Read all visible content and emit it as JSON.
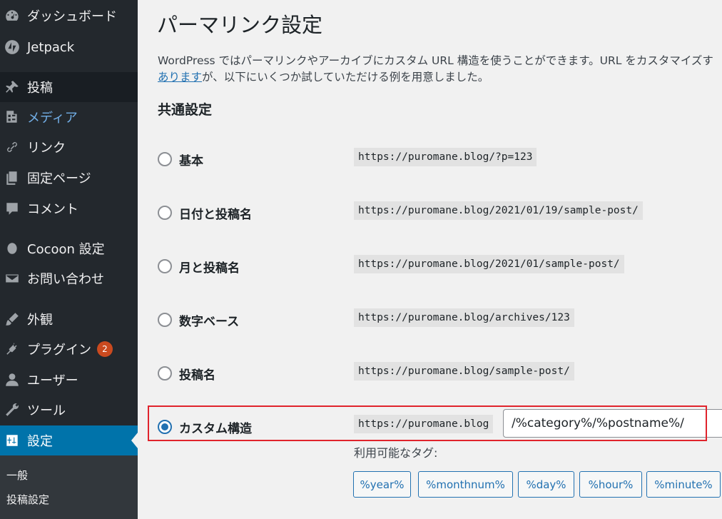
{
  "sidebar": {
    "items": [
      {
        "label": "ダッシュボード",
        "icon": "dashboard-icon"
      },
      {
        "label": "Jetpack",
        "icon": "jetpack-icon"
      },
      {
        "label": "投稿",
        "icon": "pin-icon"
      },
      {
        "label": "メディア",
        "icon": "media-icon"
      },
      {
        "label": "リンク",
        "icon": "link-icon"
      },
      {
        "label": "固定ページ",
        "icon": "pages-icon"
      },
      {
        "label": "コメント",
        "icon": "comment-icon"
      },
      {
        "label": "Cocoon 設定",
        "icon": "cocoon-icon"
      },
      {
        "label": "お問い合わせ",
        "icon": "mail-icon"
      },
      {
        "label": "外観",
        "icon": "brush-icon"
      },
      {
        "label": "プラグイン",
        "icon": "plugin-icon",
        "badge": "2"
      },
      {
        "label": "ユーザー",
        "icon": "user-icon"
      },
      {
        "label": "ツール",
        "icon": "wrench-icon"
      },
      {
        "label": "設定",
        "icon": "settings-icon"
      }
    ],
    "submenu": [
      "一般",
      "投稿設定"
    ]
  },
  "page": {
    "title": "パーマリンク設定",
    "intro_line1": "WordPress ではパーマリンクやアーカイブにカスタム URL 構造を使うことができます。URL をカスタマイズす",
    "intro_link": "あります",
    "intro_line2_rest": "が、以下にいくつか試していただける例を用意しました。",
    "section_title": "共通設定"
  },
  "options": [
    {
      "label": "基本",
      "example": "https://puromane.blog/?p=123",
      "checked": false
    },
    {
      "label": "日付と投稿名",
      "example": "https://puromane.blog/2021/01/19/sample-post/",
      "checked": false
    },
    {
      "label": "月と投稿名",
      "example": "https://puromane.blog/2021/01/sample-post/",
      "checked": false
    },
    {
      "label": "数字ベース",
      "example": "https://puromane.blog/archives/123",
      "checked": false
    },
    {
      "label": "投稿名",
      "example": "https://puromane.blog/sample-post/",
      "checked": false
    },
    {
      "label": "カスタム構造",
      "example": "https://puromane.blog",
      "checked": true
    }
  ],
  "custom_structure_value": "/%category%/%postname%/",
  "tags_label": "利用可能なタグ:",
  "tags": [
    "%year%",
    "%monthnum%",
    "%day%",
    "%hour%",
    "%minute%"
  ],
  "colors": {
    "sidebar_bg": "#23282d",
    "active_bg": "#0073aa",
    "link": "#2271b1",
    "highlight": "#e0232c"
  }
}
